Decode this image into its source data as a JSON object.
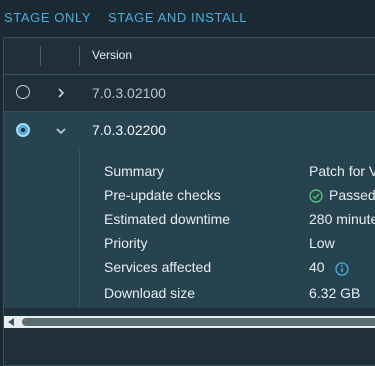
{
  "actions": {
    "stage_only": "STAGE ONLY",
    "stage_and_install": "STAGE AND INSTALL"
  },
  "table": {
    "column_title": "Version",
    "rows": [
      {
        "version": "7.0.3.02100",
        "selected": false,
        "expanded": false
      },
      {
        "version": "7.0.3.02200",
        "selected": true,
        "expanded": true,
        "details": [
          {
            "label": "Summary",
            "value": "Patch for V"
          },
          {
            "label": "Pre-update checks",
            "value": "Passed",
            "icon": "check-circle-icon"
          },
          {
            "label": "Estimated downtime",
            "value": "280 minute"
          },
          {
            "label": "Priority",
            "value": "Low"
          },
          {
            "label": "Services affected",
            "value": "40",
            "icon": "info-icon"
          },
          {
            "label": "Download size",
            "value": "6.32 GB"
          }
        ]
      }
    ]
  },
  "colors": {
    "accent": "#49aee0",
    "background": "#1b2a32",
    "selected_row": "#284350",
    "ok": "#4fbf73"
  }
}
